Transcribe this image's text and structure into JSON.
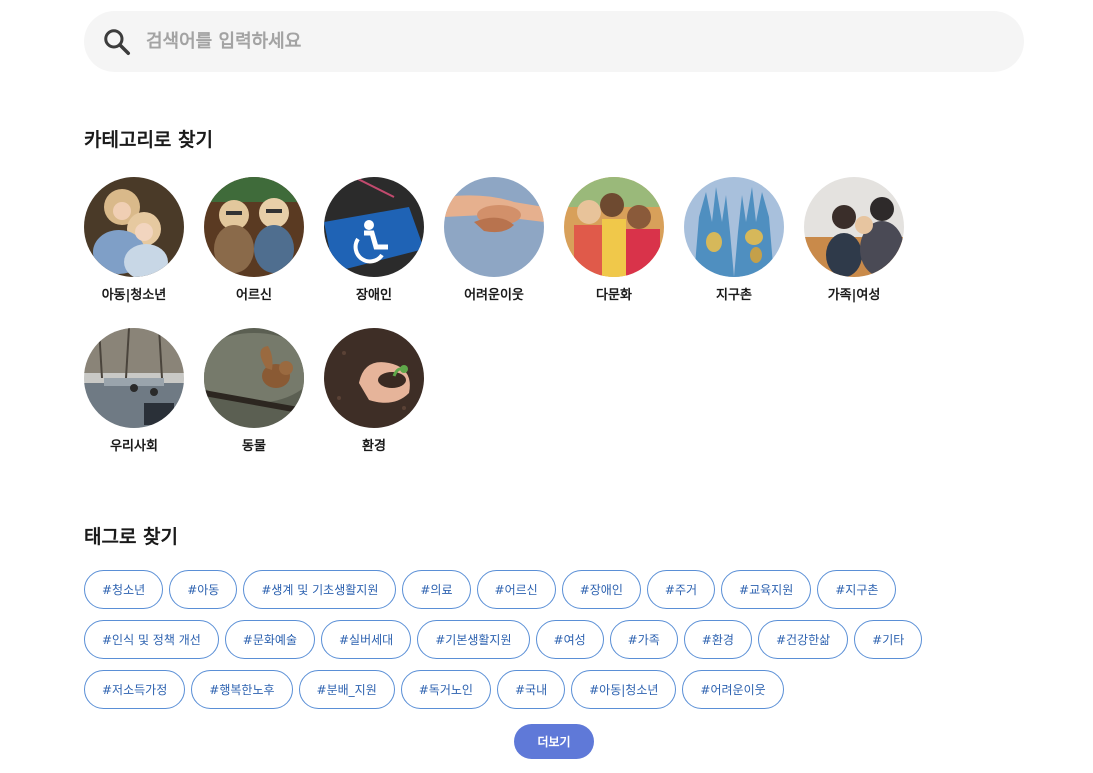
{
  "search": {
    "placeholder": "검색어를 입력하세요",
    "icon": "search-icon"
  },
  "categories": {
    "title": "카테고리로 찾기",
    "items": [
      {
        "label": "아동|청소년",
        "image": "children-hugging"
      },
      {
        "label": "어르신",
        "image": "elderly-figurines"
      },
      {
        "label": "장애인",
        "image": "wheelchair-sign"
      },
      {
        "label": "어려운이웃",
        "image": "helping-hands"
      },
      {
        "label": "다문화",
        "image": "multicultural-kids"
      },
      {
        "label": "지구촌",
        "image": "world-map-hands"
      },
      {
        "label": "가족|여성",
        "image": "family-women"
      },
      {
        "label": "우리사회",
        "image": "city-street"
      },
      {
        "label": "동물",
        "image": "squirrel"
      },
      {
        "label": "환경",
        "image": "hands-with-sprout"
      }
    ]
  },
  "tags": {
    "title": "태그로 찾기",
    "rows": [
      [
        "#청소년",
        "#아동",
        "#생계 및 기초생활지원",
        "#의료",
        "#어르신",
        "#장애인",
        "#주거",
        "#교육지원",
        "#지구촌"
      ],
      [
        "#인식 및 정책 개선",
        "#문화예술",
        "#실버세대",
        "#기본생활지원",
        "#여성",
        "#가족",
        "#환경",
        "#건강한삶",
        "#기타"
      ],
      [
        "#저소득가정",
        "#행복한노후",
        "#분배_지원",
        "#독거노인",
        "#국내",
        "#아동|청소년",
        "#어려운이웃"
      ]
    ]
  },
  "more_button": {
    "label": "더보기"
  },
  "colors": {
    "accent": "#5f79d8",
    "tag_border": "#5a8fd6",
    "tag_text": "#2d62b0"
  }
}
